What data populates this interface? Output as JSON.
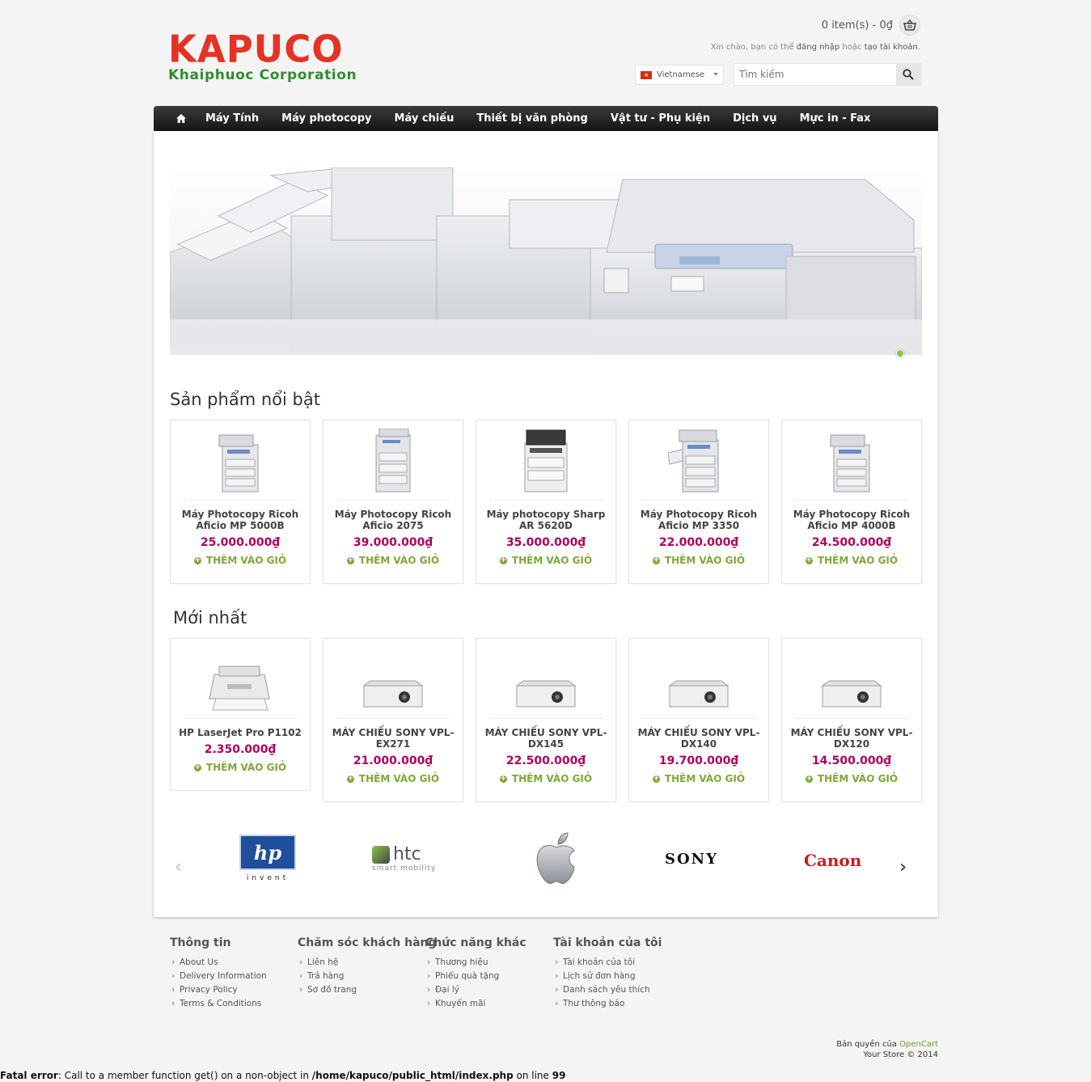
{
  "header": {
    "logo_main": "KAPUCO",
    "logo_sub": "Khaiphuoc Corporation",
    "cart_text": "0 item(s) - 0₫",
    "welcome_prefix": "Xin chào, bạn có thể",
    "login_link": "đăng nhập",
    "welcome_middle": "hoặc",
    "register_link": "tạo tài khoản",
    "welcome_suffix": ".",
    "language": "Vietnamese",
    "search_placeholder": "Tìm kiếm"
  },
  "nav": {
    "items": [
      "Máy Tính",
      "Máy photocopy",
      "Máy chiếu",
      "Thiết bị văn phòng",
      "Vật tư - Phụ kiện",
      "Dịch vụ",
      "Mực in - Fax"
    ]
  },
  "featured": {
    "title": "Sản phẩm nổi bật",
    "products": [
      {
        "name": "Máy Photocopy Ricoh Aficio MP 5000B",
        "price": "25.000.000₫",
        "cta": "THÊM VÀO GIỎ"
      },
      {
        "name": "Máy Photocopy Ricoh Aficio 2075",
        "price": "39.000.000₫",
        "cta": "THÊM VÀO GIỎ"
      },
      {
        "name": "Máy photocopy Sharp AR 5620D",
        "price": "35.000.000₫",
        "cta": "THÊM VÀO GIỎ"
      },
      {
        "name": "Máy Photocopy Ricoh Aficio MP 3350",
        "price": "22.000.000₫",
        "cta": "THÊM VÀO GIỎ"
      },
      {
        "name": "Máy Photocopy Ricoh Aficio MP 4000B",
        "price": "24.500.000₫",
        "cta": "THÊM VÀO GIỎ"
      }
    ]
  },
  "latest": {
    "title": "Mới nhất",
    "products": [
      {
        "name": "HP LaserJet Pro P1102",
        "price": "2.350.000₫",
        "cta": "THÊM VÀO GIỎ"
      },
      {
        "name": "MÁY CHIẾU SONY VPL-EX271",
        "price": "21.000.000₫",
        "cta": "THÊM VÀO GIỎ"
      },
      {
        "name": "MÁY CHIẾU SONY VPL-DX145",
        "price": "22.500.000₫",
        "cta": "THÊM VÀO GIỎ"
      },
      {
        "name": "MÁY CHIẾU SONY VPL-DX140",
        "price": "19.700.000₫",
        "cta": "THÊM VÀO GIỎ"
      },
      {
        "name": "MÁY CHIẾU SONY VPL-DX120",
        "price": "14.500.000₫",
        "cta": "THÊM VÀO GIỎ"
      }
    ]
  },
  "brands": {
    "hp": "hp",
    "hp_tag": "invent",
    "htc": "htc",
    "htc_tag": "smart mobility",
    "sony": "SONY",
    "canon": "Canon"
  },
  "footer": {
    "columns": [
      {
        "title": "Thông tin",
        "links": [
          "About Us",
          "Delivery Information",
          "Privacy Policy",
          "Terms & Conditions"
        ]
      },
      {
        "title": "Chăm sóc khách hàng",
        "links": [
          "Liên hệ",
          "Trả hàng",
          "Sơ đồ trang"
        ]
      },
      {
        "title": "Chức năng khác",
        "links": [
          "Thương hiệu",
          "Phiếu quà tặng",
          "Đại lý",
          "Khuyến mãi"
        ]
      },
      {
        "title": "Tài khoản của tôi",
        "links": [
          "Tài khoản của tôi",
          "Lịch sử đơn hàng",
          "Danh sách yêu thích",
          "Thư thông báo"
        ]
      }
    ],
    "copyright_prefix": "Bản quyền của",
    "copyright_link": "OpenCart",
    "copyright_line2": "Your Store © 2014"
  },
  "error": {
    "label": "Fatal error",
    "message_prefix": ": Call to a member function get() on a non-object in ",
    "path": "/home/kapuco/public_html/index.php",
    "message_suffix": " on line ",
    "line": "99"
  },
  "colors": {
    "logo_red": "#e53224",
    "logo_green": "#2e8f2c",
    "price": "#b0005f",
    "add_to_cart": "#7ea836"
  }
}
